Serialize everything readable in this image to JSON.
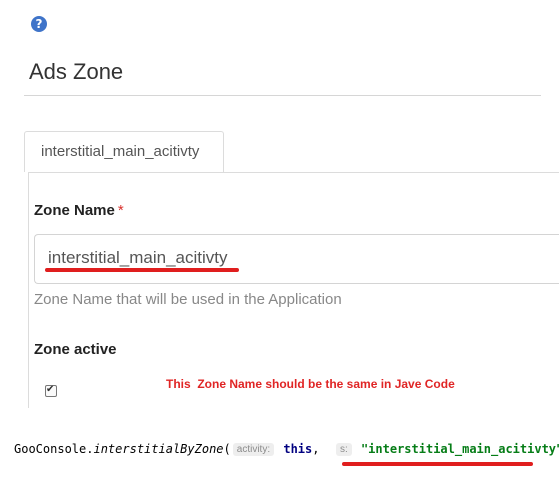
{
  "help": {
    "glyph": "?"
  },
  "page": {
    "title": "Ads Zone"
  },
  "tabs": [
    {
      "label": "interstitial_main_acitivty"
    }
  ],
  "form": {
    "zone_name": {
      "label": "Zone Name",
      "required_mark": "*",
      "value": "interstitial_main_acitivty",
      "help": "Zone Name that will be used in the Application"
    },
    "zone_active": {
      "label": "Zone active",
      "checked": true,
      "check_glyph": "✔"
    }
  },
  "annotation": {
    "text": "This  Zone Name should be the same in Jave Code",
    "color": "#e02525"
  },
  "code": {
    "object": "GooConsole.",
    "method": "interstitialByZone",
    "open_paren": "(",
    "hint_activity": "activity:",
    "arg_this": "this",
    "comma": ",",
    "hint_s": "s:",
    "arg_string": "\"interstitial_main_acitivty\"",
    "close": ");"
  },
  "colors": {
    "accent_help": "#3f74c9",
    "underline": "#e01e1e",
    "required": "#d9302c"
  }
}
